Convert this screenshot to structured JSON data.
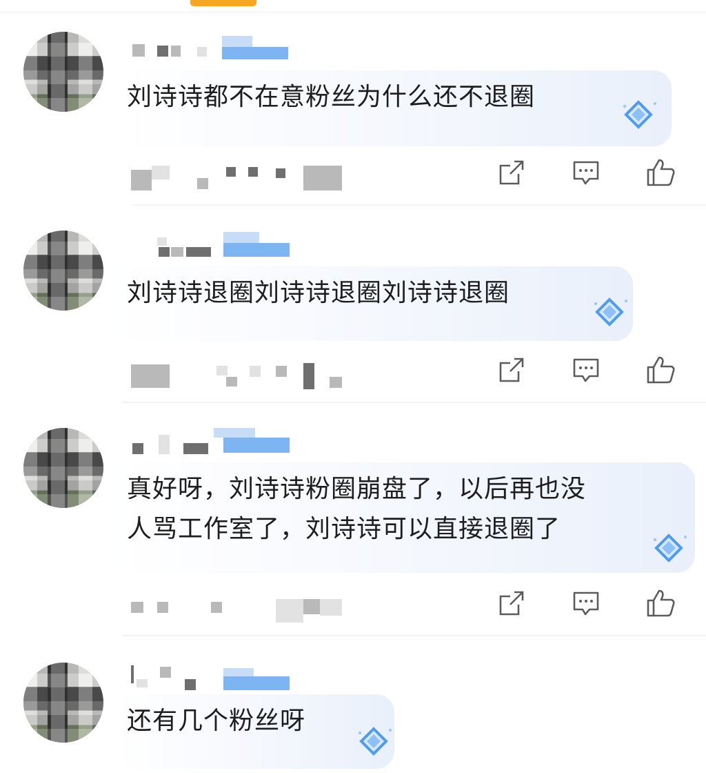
{
  "comments": [
    {
      "text": "刘诗诗都不在意粉丝为什么还不退圈"
    },
    {
      "text": "刘诗诗退圈刘诗诗退圈刘诗诗退圈"
    },
    {
      "text": "真好呀，刘诗诗粉圈崩盘了，以后再也没\n人骂工作室了，刘诗诗可以直接退圈了"
    },
    {
      "text": "还有几个粉丝呀"
    }
  ],
  "icons": {
    "share": "share-icon",
    "comment": "comment-icon",
    "like": "thumbs-up-icon",
    "badge": "diamond-badge-icon"
  },
  "colors": {
    "accent": "#f5a623",
    "badge": "#4f9bf0",
    "icon_stroke": "#5b5b5b"
  }
}
